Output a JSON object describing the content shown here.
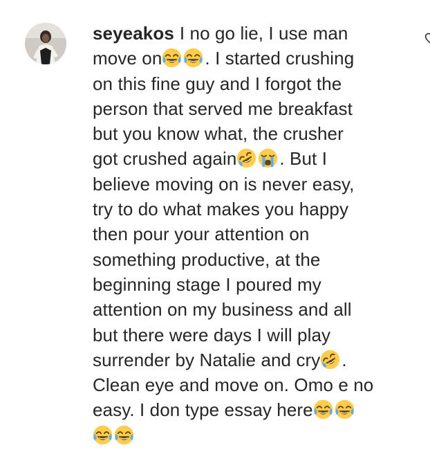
{
  "comment": {
    "username": "seyeakos",
    "lines": [
      "I no go lie, I use man",
      "move on",
      ". I started crushing",
      "on this fine guy and I forgot the",
      "person that served me breakfast",
      "but you know what, the crusher",
      "got crushed again",
      ". But I",
      "believe moving on is never easy,",
      "try to do what makes you happy",
      "then pour your attention on",
      "something productive, at the",
      "beginning stage I poured my",
      "attention on my business and all",
      "but there were days I will play",
      "surrender by Natalie and cry",
      ".",
      "Clean eye and move on. Omo e no",
      "easy. I don type essay here"
    ],
    "emojis": {
      "joy": "face-with-tears-of-joy-icon",
      "rofl": "rolling-on-floor-laughing-icon",
      "sob": "loudly-crying-face-icon"
    }
  },
  "icons": {
    "like": "heart-outline-icon",
    "avatar": "user-avatar"
  },
  "colors": {
    "text": "#262626",
    "emoji_yellow": "#ffcc4d",
    "tear_blue": "#5dadec"
  }
}
